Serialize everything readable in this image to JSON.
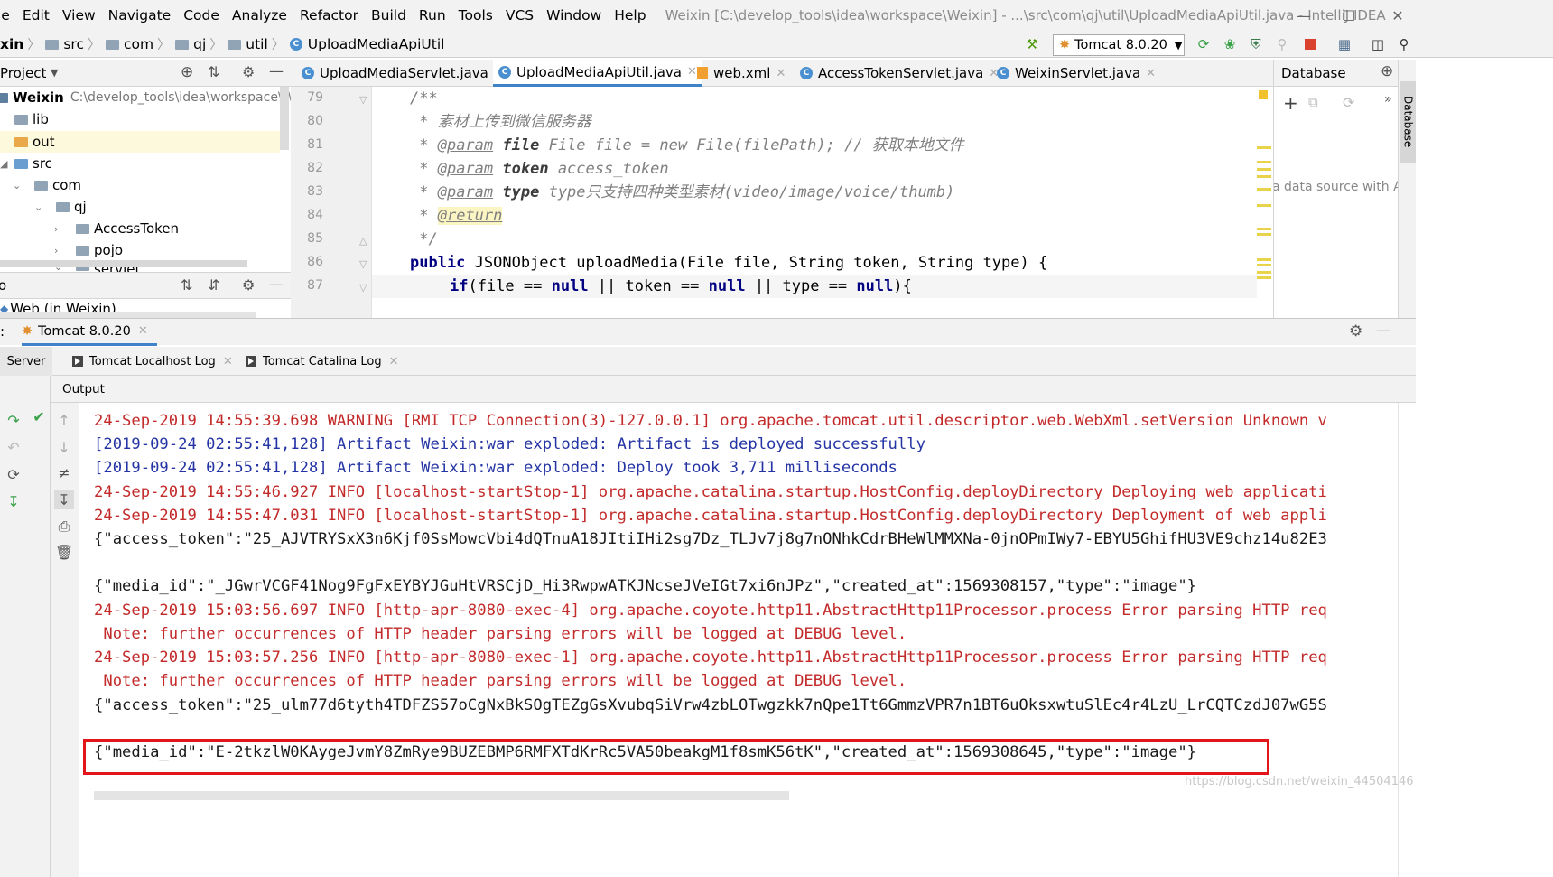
{
  "menu": {
    "items": [
      "le",
      "Edit",
      "View",
      "Navigate",
      "Code",
      "Analyze",
      "Refactor",
      "Build",
      "Run",
      "Tools",
      "VCS",
      "Window",
      "Help"
    ],
    "window_title": "Weixin [C:\\develop_tools\\idea\\workspace\\Weixin] - ...\\src\\com\\qj\\util\\UploadMediaApiUtil.java - IntelliJ IDEA"
  },
  "navbar": {
    "crumbs": [
      "xin",
      "src",
      "com",
      "qj",
      "util",
      "UploadMediaApiUtil"
    ],
    "run_config": "Tomcat 8.0.20"
  },
  "project": {
    "header": "Project",
    "root_name": "Weixin",
    "root_path": "C:\\develop_tools\\idea\\workspace\\Wei",
    "nodes": [
      "lib",
      "out",
      "src",
      "com",
      "qj",
      "AccessToken",
      "pojo",
      "servlet"
    ],
    "web_node": "Web (in Weixin)",
    "tree2_label": "o"
  },
  "editor": {
    "tabs": [
      "UploadMediaServlet.java",
      "UploadMediaApiUtil.java",
      "web.xml",
      "AccessTokenServlet.java",
      "WeixinServlet.java"
    ],
    "line_numbers": [
      "79",
      "80",
      "81",
      "82",
      "83",
      "84",
      "85",
      "86",
      "87"
    ],
    "code": {
      "l79": "/**",
      "l80_star": " * ",
      "l80_text": "素材上传到微信服务器",
      "l81_tag": "@param",
      "l81_name": "file",
      "l81_text": " File file = new File(filePath); // 获取本地文件",
      "l82_tag": "@param",
      "l82_name": "token",
      "l82_text": " access_token",
      "l83_tag": "@param",
      "l83_name": "type",
      "l83_text": " type只支持四种类型素材(video/image/voice/thumb)",
      "l84_tag": "@return",
      "l85": " */",
      "l86_kw": "public",
      "l86_rest": " JSONObject uploadMedia(File file, String token, String type) {",
      "l87_if": "if",
      "l87_a": "(file == ",
      "l87_null1": "null",
      "l87_b": " || token == ",
      "l87_null2": "null",
      "l87_c": " || type == ",
      "l87_null3": "null",
      "l87_d": "){"
    }
  },
  "database": {
    "header": "Database",
    "hint": "a data source with Alt",
    "strip_label": "Database"
  },
  "run": {
    "config_tab": "Tomcat 8.0.20",
    "tabs": [
      "Server",
      "Tomcat Localhost Log",
      "Tomcat Catalina Log"
    ],
    "output_label": "Output",
    "lines": [
      "24-Sep-2019 14:55:39.698 WARNING [RMI TCP Connection(3)-127.0.0.1] org.apache.tomcat.util.descriptor.web.WebXml.setVersion Unknown v",
      "[2019-09-24 02:55:41,128] Artifact Weixin:war exploded: Artifact is deployed successfully",
      "[2019-09-24 02:55:41,128] Artifact Weixin:war exploded: Deploy took 3,711 milliseconds",
      "24-Sep-2019 14:55:46.927 INFO [localhost-startStop-1] org.apache.catalina.startup.HostConfig.deployDirectory Deploying web applicati",
      "24-Sep-2019 14:55:47.031 INFO [localhost-startStop-1] org.apache.catalina.startup.HostConfig.deployDirectory Deployment of web appli",
      "{\"access_token\":\"25_AJVTRYSxX3n6Kjf0SsMowcVbi4dQTnuA18JItiIHi2sg7Dz_TLJv7j8g7nONhkCdrBHeWlMMXNa-0jnOPmIWy7-EBYU5GhifHU3VE9chz14u82E3",
      "{\"media_id\":\"_JGwrVCGF41Nog9FgFxEYBYJGuHtVRSCjD_Hi3RwpwATKJNcseJVeIGt7xi6nJPz\",\"created_at\":1569308157,\"type\":\"image\"}",
      "24-Sep-2019 15:03:56.697 INFO [http-apr-8080-exec-4] org.apache.coyote.http11.AbstractHttp11Processor.process Error parsing HTTP req",
      " Note: further occurrences of HTTP header parsing errors will be logged at DEBUG level.",
      "24-Sep-2019 15:03:57.256 INFO [http-apr-8080-exec-1] org.apache.coyote.http11.AbstractHttp11Processor.process Error parsing HTTP req",
      " Note: further occurrences of HTTP header parsing errors will be logged at DEBUG level.",
      "{\"access_token\":\"25_ulm77d6tyth4TDFZS57oCgNxBkSOgTEZgGsXvubqSiVrw4zbLOTwgzkk7nQpe1Tt6GmmzVPR7n1BT6uOksxwtuSlEc4r4LzU_LrCQTCzdJ07wG5S",
      "{\"media_id\":\"E-2tkzlW0KAygeJvmY8ZmRye9BUZEBMP6RMFXTdKrRc5VA50beakgM1f8smK56tK\",\"created_at\":1569308645,\"type\":\"image\"}"
    ],
    "watermark": "https://blog.csdn.net/weixin_44504146"
  },
  "colors": {
    "error_red": "#c32a2a",
    "info_blue": "#2434a4",
    "highlight_box": "#e2151b",
    "active_tab": "#4083c9"
  }
}
